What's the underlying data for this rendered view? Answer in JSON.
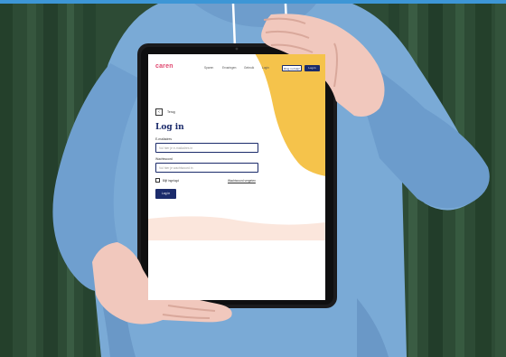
{
  "colors": {
    "curtain": "#2c4a34",
    "sweater": "#7aaad6",
    "tablet_bezel": "#1b1b1d",
    "accent_navy": "#1b2b6b",
    "logo_pink": "#e0476f",
    "blob_yellow": "#f5c34b",
    "peach": "#fbe6dc",
    "top_bar": "#3d96d6"
  },
  "tablet_screen": {
    "logo": "caren",
    "nav_items": [
      "Sparen",
      "Ervaringen",
      "Gebruik",
      "Login"
    ],
    "header_buttons": {
      "secondary": "Ring nu hulp!",
      "primary": "Log in"
    },
    "back_label": "Terug",
    "heading": "Log in",
    "username_label": "E-mailadres",
    "username_placeholder": "Vul hier je e-mailadres in",
    "password_label": "Wachtwoord",
    "password_placeholder": "Vul hier je wachtwoord in",
    "remember_label": "Blijf ingelogd",
    "forgot_link": "Wachtwoord vergeten",
    "submit_label": "Log in"
  }
}
